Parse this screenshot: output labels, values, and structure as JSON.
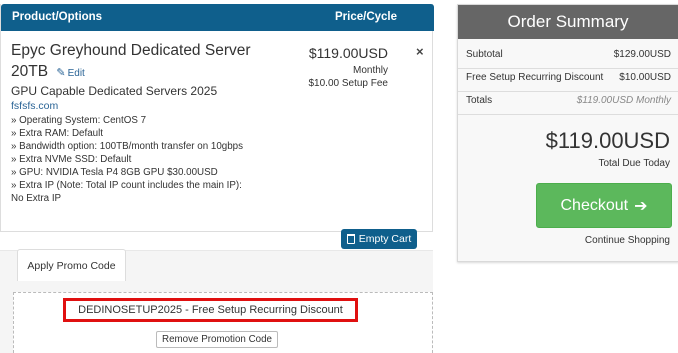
{
  "cart": {
    "header": {
      "product_label": "Product/Options",
      "price_label": "Price/Cycle"
    },
    "item": {
      "title": "Epyc Greyhound Dedicated Server 20TB",
      "edit_label": "Edit",
      "group": "GPU Capable Dedicated Servers 2025",
      "domain": "fsfsfs.com",
      "config": [
        "» Operating System: CentOS 7",
        "» Extra RAM: Default",
        "» Bandwidth option: 100TB/month transfer on 10gbps",
        "» Extra NVMe SSD: Default",
        "» GPU: NVIDIA Tesla P4 8GB GPU $30.00USD",
        "» Extra IP (Note: Total IP count includes the main IP): No Extra IP"
      ],
      "price": "$119.00USD",
      "cycle": "Monthly",
      "setup_fee": "$10.00 Setup Fee",
      "remove_symbol": "×"
    },
    "empty_cart_label": "Empty Cart"
  },
  "promo": {
    "tab_label": "Apply Promo Code",
    "applied_code": "DEDINOSETUP2025 - Free Setup Recurring Discount",
    "remove_label": "Remove Promotion Code"
  },
  "summary": {
    "title": "Order Summary",
    "subtotal_label": "Subtotal",
    "subtotal_value": "$129.00USD",
    "discount_label": "Free Setup Recurring Discount",
    "discount_value": "$10.00USD",
    "totals_label": "Totals",
    "totals_value": "$119.00USD Monthly",
    "total_due": "$119.00USD",
    "total_due_label": "Total Due Today",
    "checkout_label": "Checkout",
    "continue_label": "Continue Shopping"
  },
  "colors": {
    "header_blue": "#0f5f8c",
    "summary_header": "#666666",
    "checkout_green": "#5cb85c",
    "promo_highlight": "#e01010"
  }
}
